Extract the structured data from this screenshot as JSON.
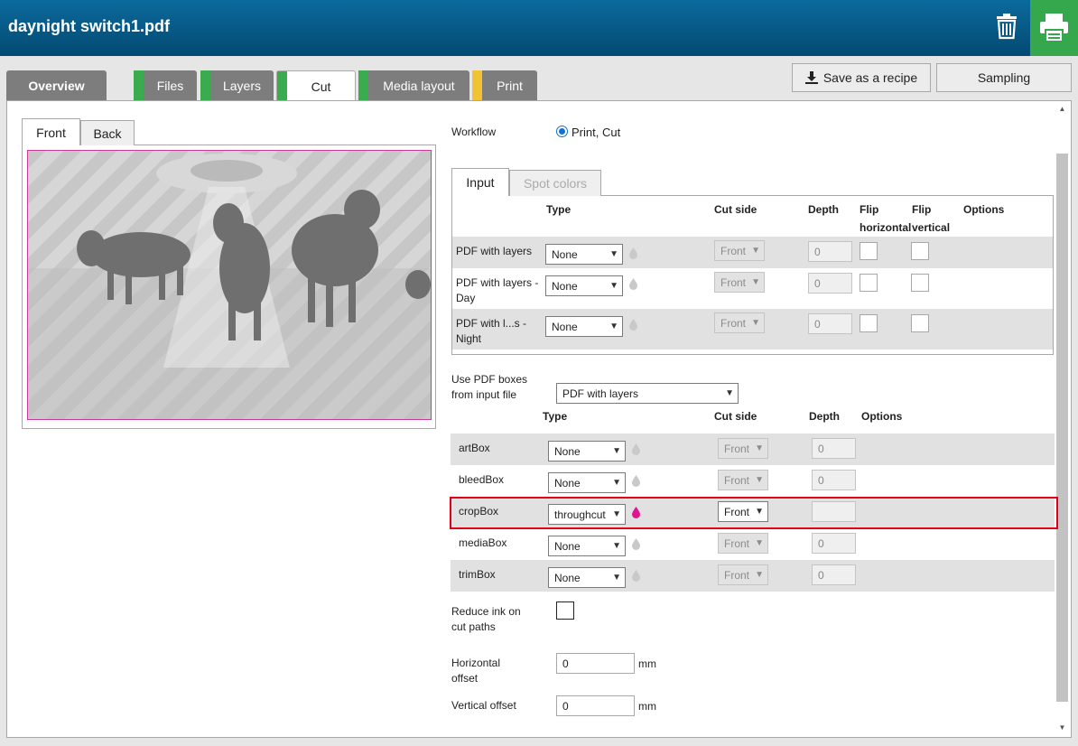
{
  "header": {
    "title": "daynight switch1.pdf",
    "icons": [
      "trash-icon",
      "printer-icon"
    ],
    "print_color": "#35a84e"
  },
  "tabs": [
    {
      "label": "Overview",
      "status": null
    },
    {
      "label": "Files",
      "status": "#3aac4f"
    },
    {
      "label": "Layers",
      "status": "#3aac4f"
    },
    {
      "label": "Cut",
      "status": "#3aac4f",
      "active": true
    },
    {
      "label": "Media layout",
      "status": "#3aac4f"
    },
    {
      "label": "Print",
      "status": "#f1c232"
    }
  ],
  "actions": {
    "save_recipe": "Save as a recipe",
    "sampling": "Sampling"
  },
  "preview": {
    "tab_front": "Front",
    "tab_back": "Back"
  },
  "workflow": {
    "label": "Workflow",
    "value": "Print, Cut"
  },
  "input_tabs": {
    "input": "Input",
    "spot": "Spot colors"
  },
  "input_headers": {
    "type": "Type",
    "cut_side": "Cut side",
    "depth": "Depth",
    "flip_h_1": "Flip",
    "flip_h_2": "horizontal",
    "flip_v_1": "Flip",
    "flip_v_2": "vertical",
    "options": "Options"
  },
  "layer_rows": [
    {
      "name": "PDF with layers",
      "type": "None",
      "cut_side": "Front",
      "depth": "0"
    },
    {
      "name": "PDF with layers - Day",
      "type": "None",
      "cut_side": "Front",
      "depth": "0"
    },
    {
      "name": "PDF with l...s - Night",
      "type": "None",
      "cut_side": "Front",
      "depth": "0"
    }
  ],
  "pdf_boxes": {
    "label": "Use PDF boxes from input file",
    "value": "PDF with layers"
  },
  "box_headers": {
    "type": "Type",
    "cut_side": "Cut side",
    "depth": "Depth",
    "options": "Options"
  },
  "box_rows": [
    {
      "name": "artBox",
      "type": "None",
      "cut_side": "Front",
      "depth": "0"
    },
    {
      "name": "bleedBox",
      "type": "None",
      "cut_side": "Front",
      "depth": "0"
    },
    {
      "name": "cropBox",
      "type": "throughcut",
      "cut_side": "Front",
      "depth": "",
      "active": true
    },
    {
      "name": "mediaBox",
      "type": "None",
      "cut_side": "Front",
      "depth": "0"
    },
    {
      "name": "trimBox",
      "type": "None",
      "cut_side": "Front",
      "depth": "0"
    }
  ],
  "reduce_ink": {
    "label": "Reduce ink on cut paths"
  },
  "h_offset": {
    "label": "Horizontal offset",
    "value": "0",
    "unit": "mm"
  },
  "v_offset": {
    "label": "Vertical offset",
    "value": "0",
    "unit": "mm"
  }
}
